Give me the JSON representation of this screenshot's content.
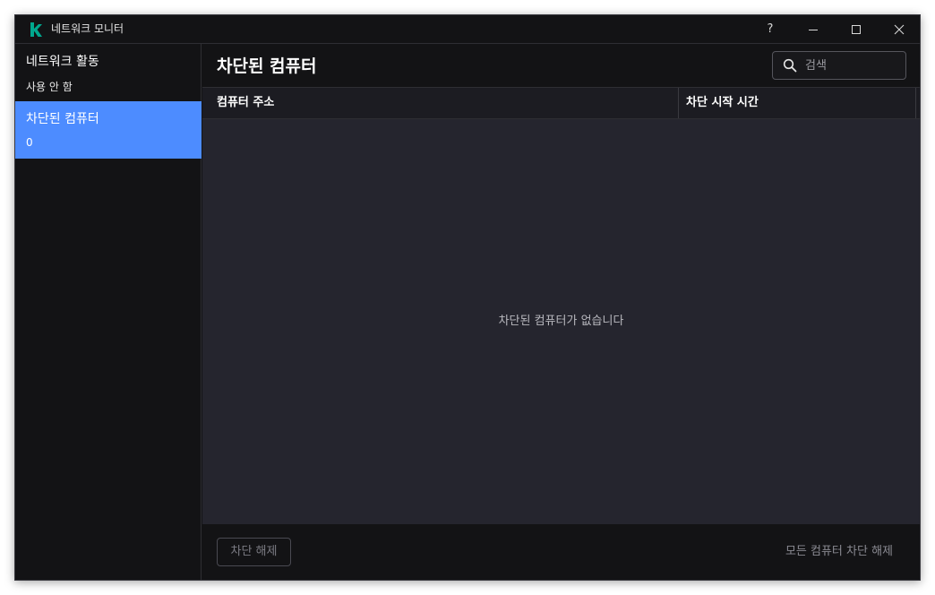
{
  "window": {
    "title": "네트워크 모니터",
    "help_label": "?"
  },
  "sidebar": {
    "items": [
      {
        "label": "네트워크 활동",
        "sub": "사용 안 함",
        "active": false
      },
      {
        "label": "차단된 컴퓨터",
        "sub": "0",
        "active": true
      }
    ]
  },
  "main": {
    "title": "차단된 컴퓨터",
    "search": {
      "placeholder": "검색",
      "value": ""
    },
    "table": {
      "columns": [
        "컴퓨터 주소",
        "차단 시작 시간"
      ],
      "rows": [],
      "empty_message": "차단된 컴퓨터가 없습니다"
    },
    "footer": {
      "unblock_label": "차단 해제",
      "unblock_all_label": "모든 컴퓨터 차단 해제"
    }
  },
  "colors": {
    "accent": "#4d8cff",
    "logo": "#00a88e",
    "background": "#131315",
    "table_body": "#25252e"
  },
  "icons": {
    "logo": "kaspersky-k-icon",
    "search": "search-icon",
    "minimize": "minimize-icon",
    "maximize": "maximize-icon",
    "close": "close-icon"
  }
}
